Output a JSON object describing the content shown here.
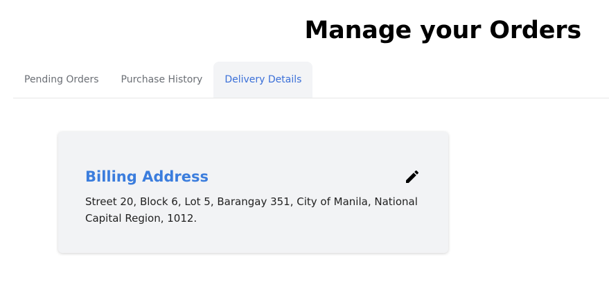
{
  "header": {
    "title": "Manage your Orders"
  },
  "tabs": [
    {
      "label": "Pending Orders",
      "active": false
    },
    {
      "label": "Purchase History",
      "active": false
    },
    {
      "label": "Delivery Details",
      "active": true
    }
  ],
  "billing": {
    "title": "Billing Address",
    "address": "Street 20, Block 6, Lot 5, Barangay 351, City of Manila, National Capital Region, 1012.",
    "edit_icon": "pencil-icon"
  },
  "colors": {
    "accent": "#3b7ddd",
    "active_tab_text": "#3a6fd8",
    "card_background": "#f2f3f5",
    "active_tab_background": "#f3f4f6"
  }
}
